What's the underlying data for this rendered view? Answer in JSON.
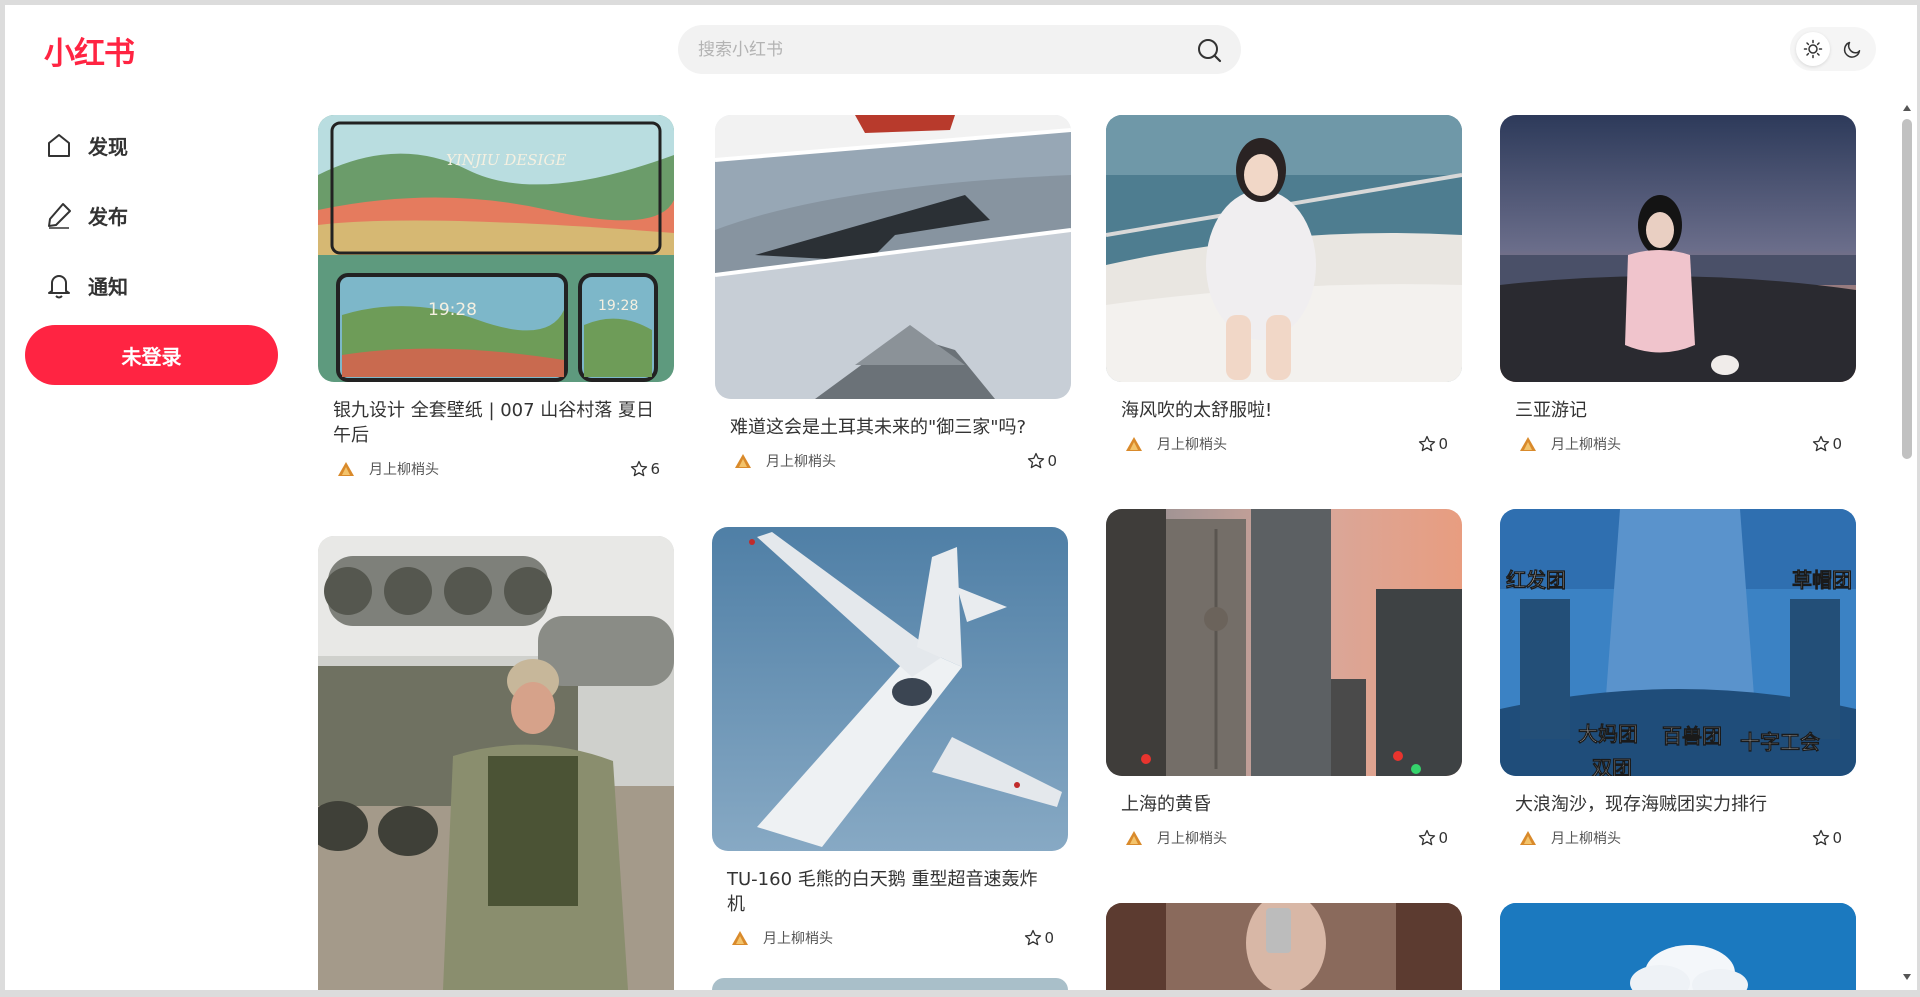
{
  "header": {
    "logo": "小红书",
    "search_placeholder": "搜索小红书"
  },
  "sidebar": {
    "items": [
      {
        "label": "发现",
        "icon": "home-icon"
      },
      {
        "label": "发布",
        "icon": "pen-icon"
      },
      {
        "label": "通知",
        "icon": "bell-icon"
      }
    ],
    "login_label": "未登录"
  },
  "colors": {
    "brand": "#ff2442",
    "search_bg": "#f2f2f2"
  },
  "feed": [
    {
      "title": "银九设计 全套壁纸 | 007 山谷村落 夏日午后",
      "author": "月上柳梢头",
      "likes": "6",
      "image": "valley-village-wallpaper",
      "image_text": "YINJIU DESIGE"
    },
    {
      "title": "难道这会是土耳其未来的\"御三家\"吗?",
      "author": "月上柳梢头",
      "likes": "0",
      "image": "fighter-jets-collage"
    },
    {
      "title": "海风吹的太舒服啦!",
      "author": "月上柳梢头",
      "likes": "0",
      "image": "girl-on-boat"
    },
    {
      "title": "三亚游记",
      "author": "月上柳梢头",
      "likes": "0",
      "image": "girl-on-beach-sunset"
    },
    {
      "title": "",
      "author": "",
      "likes": "",
      "image": "soldier-with-rocket-launcher"
    },
    {
      "title": "TU-160 毛熊的白天鹅 重型超音速轰炸机",
      "author": "月上柳梢头",
      "likes": "0",
      "image": "tu160-bomber"
    },
    {
      "title": "上海的黄昏",
      "author": "月上柳梢头",
      "likes": "0",
      "image": "shanghai-towers-dusk"
    },
    {
      "title": "大浪淘沙，现存海贼团实力排行",
      "author": "月上柳梢头",
      "likes": "0",
      "image": "pirate-crews-manga",
      "image_labels": [
        "红发团",
        "草帽团",
        "大妈团",
        "百兽团",
        "十字工会",
        "双团"
      ]
    }
  ]
}
